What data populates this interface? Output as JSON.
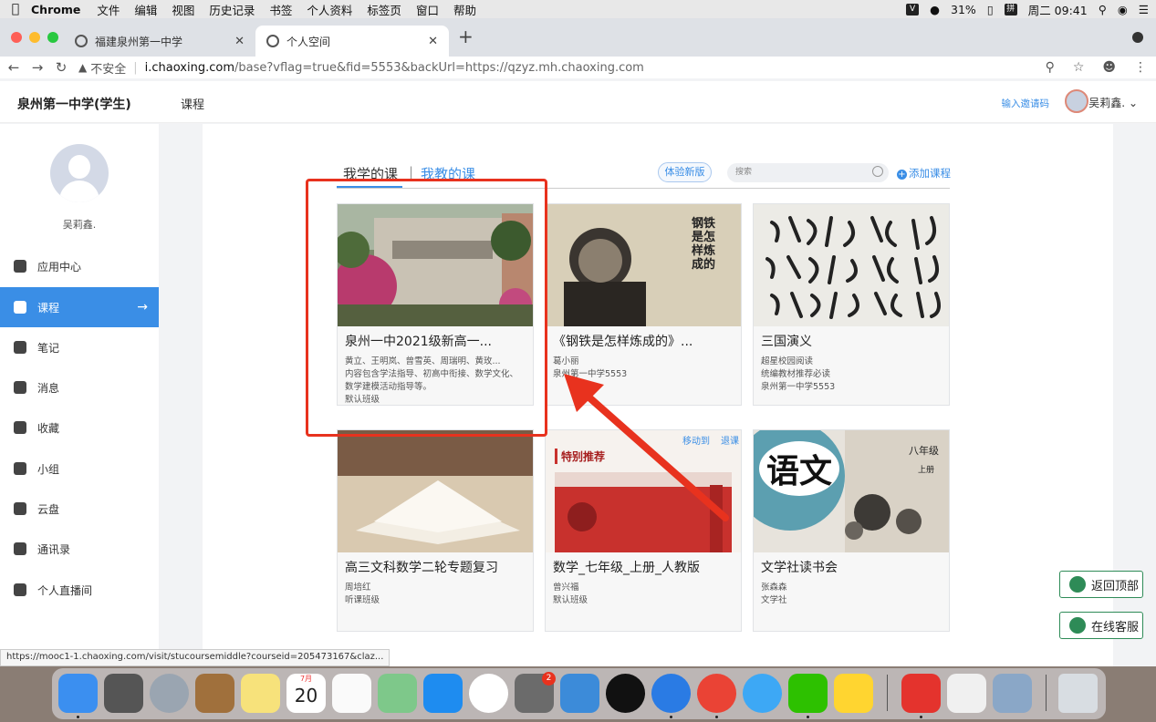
{
  "menubar": {
    "app": "Chrome",
    "items": [
      "文件",
      "编辑",
      "视图",
      "历史记录",
      "书签",
      "个人资料",
      "标签页",
      "窗口",
      "帮助"
    ],
    "battery": "31%",
    "datetime": "周二 09:41"
  },
  "tabs": [
    {
      "label": "福建泉州第一中学"
    },
    {
      "label": "个人空间"
    }
  ],
  "address": {
    "security": "不安全",
    "host": "i.chaoxing.com",
    "path": "/base?vflag=true&fid=5553&backUrl=https://qzyz.mh.chaoxing.com"
  },
  "header": {
    "school": "泉州第一中学(学生)",
    "nav_course": "课程",
    "invite": "输入邀请码",
    "user": "吴莉鑫."
  },
  "sidebar": {
    "name": "吴莉鑫.",
    "items": [
      {
        "label": "应用中心"
      },
      {
        "label": "课程"
      },
      {
        "label": "笔记"
      },
      {
        "label": "消息"
      },
      {
        "label": "收藏"
      },
      {
        "label": "小组"
      },
      {
        "label": "云盘"
      },
      {
        "label": "通讯录"
      },
      {
        "label": "个人直播间"
      }
    ]
  },
  "main": {
    "tab_learn": "我学的课",
    "tab_sep": "|",
    "tab_teach": "我教的课",
    "try_new": "体验新版",
    "search_placeholder": "搜索",
    "add_course": "添加课程",
    "move_to": "移动到",
    "quit": "退课",
    "courses": [
      {
        "title": "泉州一中2021级新高一...",
        "lines": [
          "黄立、王明岚、曾雪英、周瑞明、黄玫...",
          "内容包含学法指导、初高中衔接、数学文化、",
          "数学建模活动指导等。",
          "默认班级"
        ]
      },
      {
        "title": "《钢铁是怎样炼成的》...",
        "lines": [
          "葛小丽",
          "泉州第一中学5553"
        ]
      },
      {
        "title": "三国演义",
        "lines": [
          "超星校园阅读",
          "统编教材推荐必读",
          "泉州第一中学5553"
        ]
      },
      {
        "title": "高三文科数学二轮专题复习",
        "lines": [
          "周培红",
          "听课班级"
        ]
      },
      {
        "title": "数学_七年级_上册_人教版",
        "lines": [
          "曾兴福",
          "默认班级"
        ]
      },
      {
        "title": "文学社读书会",
        "lines": [
          "张森森",
          "文学社"
        ]
      }
    ],
    "cover_text": {
      "steel": "钢铁是怎样炼成的",
      "special": "特别推荐",
      "yuwen": "语文",
      "grade": "八年级",
      "volume": "上册"
    }
  },
  "float": {
    "top": "返回顶部",
    "service": "在线客服"
  },
  "status_url": "https://mooc1-1.chaoxing.com/visit/stucoursemiddle?courseid=205473167&claz...",
  "dock": {
    "calendar_month": "7月",
    "calendar_day": "20",
    "badge": "2"
  }
}
